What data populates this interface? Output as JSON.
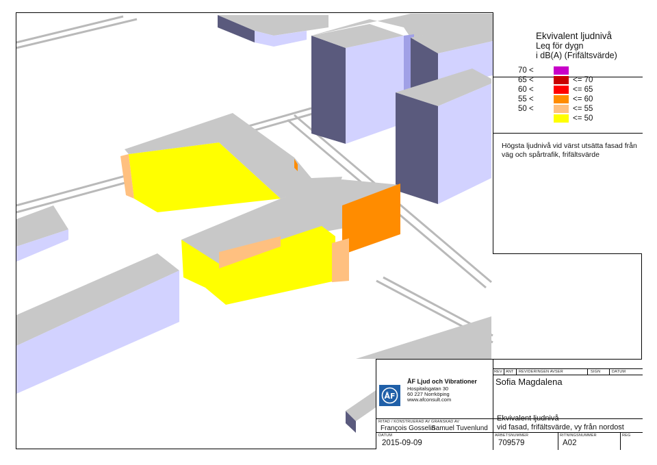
{
  "legend": {
    "title_line1": "Ekvivalent ljudnivå",
    "title_line2": "Leq för dygn",
    "title_line3": "i dB(A) (Frifältsvärde)",
    "rows": [
      {
        "lo": "70 <",
        "hi": "",
        "color": "#c800c8"
      },
      {
        "lo": "65 <",
        "hi": "<= 70",
        "color": "#c80000"
      },
      {
        "lo": "60 <",
        "hi": "<= 65",
        "color": "#ff0000"
      },
      {
        "lo": "55 <",
        "hi": "<= 60",
        "color": "#ff8c00"
      },
      {
        "lo": "50 <",
        "hi": "<= 55",
        "color": "#ffc080"
      },
      {
        "lo": "",
        "hi": "<= 50",
        "color": "#ffff00"
      }
    ],
    "note": "Högsta ljudnivå vid värst utsätta fasad från väg och spårtrafik, frifältsvärde"
  },
  "title_block": {
    "company": "ÅF Ljud och Vibrationer",
    "address1": "Hospitalsgatan 30",
    "address2": "60 227 Norrköping",
    "web": "www.afconsult.com",
    "rev_headers": [
      "REV",
      "ANT",
      "REVIDERINGEN AVSER",
      "SIGN",
      "DATUM"
    ],
    "project": "Sofia Magdalena",
    "drawn_label": "RITAD / KONSTRUERAD AV",
    "checked_label": "GRANSKAD AV",
    "drawn_by": "François Gosselin",
    "checked_by": "Samuel Tuvenlund",
    "drawing_title1": "Ekvivalent ljudnivå",
    "drawing_title2": "vid fasad, frifältsvärde, vy från nordost",
    "date_label": "DATUM",
    "date": "2015-09-09",
    "art_label": "ARBETSNUMMER",
    "art_no": "709579",
    "dwg_label": "RITNINGSNUMMER",
    "dwg_no": "A02",
    "reg_label": "REG"
  },
  "colors": {
    "roof": "#c8c8c8",
    "wall_light": "#d2d2ff",
    "wall_dark": "#5a5a7d",
    "yellow": "#ffff00",
    "peach": "#ffc080",
    "orange": "#ff8c00",
    "road": "#b4b4b4"
  }
}
